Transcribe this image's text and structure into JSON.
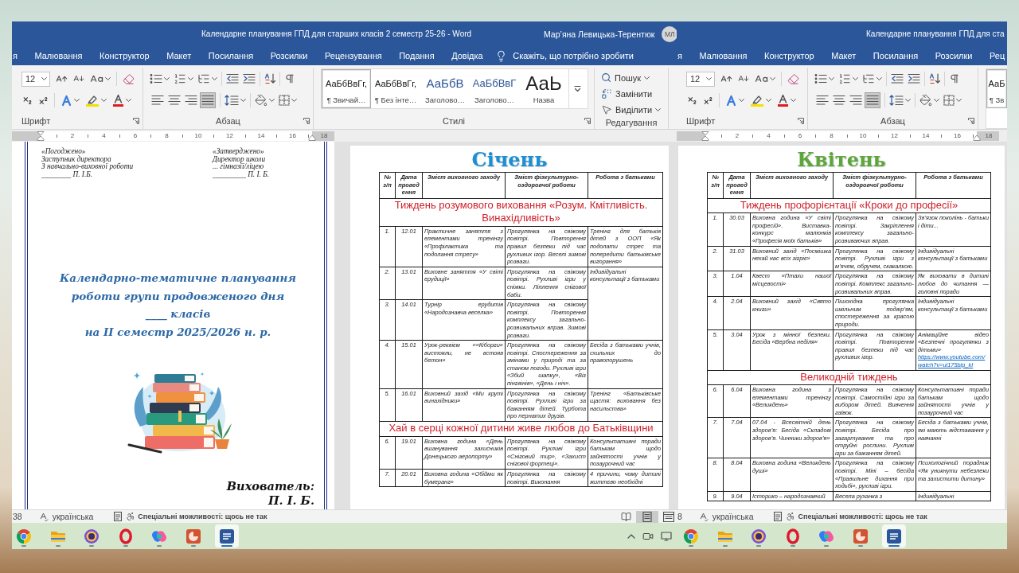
{
  "windows": [
    {
      "title": "Календарне планування ГПД для старших класів 2 семестр 25-26 - Word",
      "user_name": "Мар’яна Левицька-Терентюк",
      "user_initials": "МЛ",
      "tabs": [
        "я",
        "Малювання",
        "Конструктор",
        "Макет",
        "Посилання",
        "Розсилки",
        "Рецензування",
        "Подання",
        "Довідка"
      ],
      "tell_me": "Скажіть, що потрібно зробити",
      "ribbon": {
        "font_size": "12",
        "font_label": "Шрифт",
        "paragraph_label": "Абзац",
        "align_buttons": [
          {
            "kind": "left",
            "selected": false
          },
          {
            "kind": "center",
            "selected": false
          },
          {
            "kind": "right",
            "selected": false
          },
          {
            "kind": "justify",
            "selected": true
          }
        ],
        "styles": {
          "label": "Стилі",
          "tiles": [
            {
              "kind": "normal",
              "sample": "АаБбВвГг,",
              "name": "¶ Звичай…",
              "selected": true
            },
            {
              "kind": "no_spacing",
              "sample": "АаБбВвГг,",
              "name": "¶ Без інте…",
              "selected": false
            },
            {
              "kind": "heading1",
              "sample": "АаБбВ",
              "name": "Заголово…",
              "selected": false
            },
            {
              "kind": "heading2",
              "sample": "АаБбВвГ",
              "name": "Заголово…",
              "selected": false
            },
            {
              "kind": "title",
              "sample": "АаЬ",
              "name": "Назва",
              "selected": false
            }
          ]
        },
        "editing": {
          "label": "Редагування",
          "items": [
            {
              "kind": "find",
              "label": "Пошук",
              "menu": true
            },
            {
              "kind": "replace",
              "label": "Замінити",
              "menu": false
            },
            {
              "kind": "select",
              "label": "Виділити",
              "menu": true
            }
          ]
        }
      },
      "ruler": [
        "2",
        "4",
        "6",
        "8",
        "10",
        "12",
        "14",
        "16",
        "18"
      ],
      "pages": [
        {
          "kind": "cover",
          "approvals": [
            {
              "heading": "«Погоджено»",
              "lines": [
                "Заступник директора",
                "З навчально-виховної роботи",
                "________ П. І.Б."
              ]
            },
            {
              "heading": "«Затверджено»",
              "lines": [
                "Директор школи",
                "... гімназії/ліцею",
                "_________ П. І. Б."
              ]
            }
          ],
          "title_lines": [
            "Календарно-тематичне планування",
            "роботи групи продовженого дня",
            "____ класів",
            "на ІІ семестр 2025/2026 н. р."
          ],
          "signature_label": "Вихователь:",
          "signature_name": "П. І. Б."
        },
        {
          "kind": "plan",
          "title": "Січень",
          "color": "#1b8fd3",
          "columns": [
            "№ з/п",
            "Дата проведення",
            "Зміст виховного заходу",
            "Зміст фізкультурно-оздоровчої роботи",
            "Робота з батьками"
          ],
          "sections": [
            {
              "title": "Тиждень розумового виховання «Розум. Кмітливість. Винахідливість»",
              "rows": [
                {
                  "cells": [
                    "1.",
                    "12.01",
                    "Практичне заняття з елементами тренінгу «Профілактика та подолання стресу»",
                    "Прогулянка на свіжому повітрі. Повторення правил безпеки під час рухливих ігор. Веселі зимові розваги.",
                    "Тренінг для батьків дітей з ООП «Як подолати стрес та попередити батьківське вигорання»"
                  ]
                },
                {
                  "cells": [
                    "2.",
                    "13.01",
                    "Виховне заняття «У світі ерудиції»",
                    "Прогулянка на свіжому повітрі. Рухливі ігри у сніжки. Ліплення снігової баби.",
                    {
                      "text": "Індивідуальні консультації з батьками",
                      "rowspan": 2
                    }
                  ]
                },
                {
                  "cells": [
                    "3.",
                    "14.01",
                    "Турнір ерудитів «Народознавча веселка»",
                    "Прогулянка на свіжому повітрі. Повторення комплексу загально-розвивальних вправ. Зимові розваги."
                  ]
                },
                {
                  "cells": [
                    "4.",
                    "15.01",
                    "Урок-реквієм ««Кіборги» вистояли, не встояв бетон»",
                    "Прогулянка на свіжому повітрі. Спостереження за змінами у природі та за станом погоди. Рухливі ігри «Збий шапку», «Віз пінгвінів», «День і ніч».",
                    "Бесіда з батьками учнів, схильних до правопорушень"
                  ]
                },
                {
                  "cells": [
                    "5.",
                    "16.01",
                    "Виховний захід «Ми круті винахідники»",
                    "Прогулянка на свіжому повітрі. Рухливі ігри за бажанням дітей. Турбота про пернатих друзів.",
                    "Тренінг «Батьківське щастя: виховання без насильства»"
                  ]
                }
              ]
            },
            {
              "title": "Хай в серці кожної дитини живе любов до Батьківщини",
              "rows": [
                {
                  "cells": [
                    "6.",
                    "19.01",
                    "Виховна година «День вшанування захисників Донецького аеропорту»",
                    "Прогулянка на свіжому повітрі. Рухливі ігри «Сніговий тир», «Захист снігової фортеці».",
                    "Консультативні поради батькам щодо зайнятості учнів у позаурочний час"
                  ]
                },
                {
                  "cells": [
                    "7.",
                    "20.01",
                    "Виховна година «Обійми як бумеранг»",
                    "Прогулянка на свіжому повітрі. Виконання",
                    "4 причини, чому дитині життєво необхідні"
                  ]
                }
              ]
            }
          ]
        }
      ],
      "status_bar": {
        "page": "38",
        "language": "українська",
        "accessibility": "Спеціальні можливості: щось не так",
        "views": [
          {
            "kind": "read",
            "selected": false
          },
          {
            "kind": "print",
            "selected": true
          },
          {
            "kind": "web",
            "selected": false
          }
        ]
      },
      "taskbar": {
        "apps": [
          {
            "kind": "wheel",
            "running": true,
            "selected": false
          },
          {
            "kind": "folder",
            "running": true,
            "selected": false
          },
          {
            "kind": "ring",
            "running": true,
            "selected": false
          },
          {
            "kind": "o_ring",
            "running": true,
            "selected": false
          },
          {
            "kind": "swirl",
            "running": true,
            "selected": false
          },
          {
            "kind": "slides",
            "running": true,
            "selected": false
          },
          {
            "kind": "document",
            "running": true,
            "selected": true
          }
        ],
        "tray": [
          {
            "kind": "chevron"
          },
          {
            "kind": "camera"
          },
          {
            "kind": "screen"
          }
        ]
      }
    },
    {
      "title": "Календарне планування ГПД для ста",
      "tabs": [
        "я",
        "Малювання",
        "Конструктор",
        "Макет",
        "Посилання",
        "Розсилки",
        "Рец"
      ],
      "ribbon": {
        "font_size": "12",
        "font_label": "Шрифт",
        "paragraph_label": "Абзац",
        "align_buttons": [
          {
            "kind": "left",
            "selected": false
          },
          {
            "kind": "center",
            "selected": false
          },
          {
            "kind": "right",
            "selected": false
          },
          {
            "kind": "justify",
            "selected": true
          }
        ],
        "styles": {
          "tiles": [
            {
              "kind": "normal",
              "sample": "АаБ",
              "name": "¶ Зв",
              "selected": true
            }
          ]
        }
      },
      "ruler": [
        "2",
        "4",
        "6",
        "8",
        "10",
        "12",
        "14",
        "16",
        "18"
      ],
      "pages": [
        {
          "kind": "plan",
          "title": "Квітень",
          "color": "#5da63c",
          "columns": [
            "№ з/п",
            "Дата проведення",
            "Зміст виховного заходу",
            "Зміст фізкультурно-оздоровчої роботи",
            "Робота з батьками"
          ],
          "sections": [
            {
              "title": "Тиждень профорієнтації «Кроки до професії»",
              "rows": [
                {
                  "cells": [
                    "1.",
                    "30.03",
                    "Виховна година «У світі професій». Виставка-конкурс малюнків «Професія моїх батьків»",
                    "Прогулянка на свіжому повітрі. Закріплення комплексу загально-розвиваючих вправ.",
                    "Зв’язок поколінь - батьки і діти..."
                  ]
                },
                {
                  "cells": [
                    "2.",
                    "31.03",
                    "Виховний захід «Посмішка нехай нас всіх зігріє»",
                    "Прогулянка на свіжому повітрі. Рухливі ігри з м’ячем, обручем, скакалкою.",
                    "Індивідуальні консультації з батьками"
                  ]
                },
                {
                  "cells": [
                    "3.",
                    "1.04",
                    "Квест «Птахи нашої місцевості»",
                    "Прогулянка на свіжому повітрі. Комплекс загально-розвивальних вправ.",
                    "Як виховати в дитині любов до читання — головні поради"
                  ]
                },
                {
                  "cells": [
                    "4.",
                    "2.04",
                    "Виховний захід «Свято книги»",
                    "Пішохідна прогулянка шкільним подвір’ям, спостереження за красою природи.",
                    "Індивідуальні консультації з батьками"
                  ]
                },
                {
                  "cells": [
                    "5.",
                    "3.04",
                    "Урок з мінної безпеки. Бесіда «Вербна неділя»",
                    "Прогулянка на свіжому повітрі. Повторення правил безпеки під час рухливих ігор.",
                    "Анімаційне відео «Безпечні прогулянки з дітьми»"
                  ],
                  "link": "https://www.youtube.com/watch?v=ui175bip_kI"
                }
              ]
            },
            {
              "title": "Великодній тиждень",
              "rows": [
                {
                  "cells": [
                    "6.",
                    "6.04",
                    "Виховна година з елементами тренінгу «Великдень»",
                    "Прогулянка на свіжому повітрі. Самостійні ігри за вибором дітей. Вивчення гаївок.",
                    "Консультативні поради батькам щодо зайнятості учнів у позаурочний час"
                  ]
                },
                {
                  "cells": [
                    "7.",
                    "7.04",
                    "07.04 - Всесвітній день здоров’я: Бесіда «Складові здоров’я. Чинники здоров’я»",
                    "Прогулянка на свіжому повітрі. Бесіда про загартування та про отруйні рослини. Рухливі ігри за бажанням дітей.",
                    "Бесіда з батьками учнів, які мають відставання у навчанні"
                  ]
                },
                {
                  "cells": [
                    "8.",
                    "8.04",
                    "Виховна година «Великдень душі»",
                    "Прогулянка на свіжому повітрі. Міні – бесіда «Правильне дихання при ходьбі», рухливі ігри.",
                    "Психологічний порадник «Як уникнути небезпеки та захистити дитину»"
                  ]
                },
                {
                  "cells": [
                    "9.",
                    "9.04",
                    "Історико – народознавчий",
                    "Весела руханка з",
                    "Індивідуальні"
                  ]
                }
              ]
            }
          ]
        }
      ],
      "status_bar": {
        "page": "8",
        "language": "українська",
        "accessibility": "Спеціальні можливості: щось не так"
      },
      "taskbar": {
        "apps": [
          {
            "kind": "wheel",
            "running": true,
            "selected": false
          },
          {
            "kind": "folder",
            "running": true,
            "selected": false
          },
          {
            "kind": "ring",
            "running": true,
            "selected": false
          },
          {
            "kind": "o_ring",
            "running": true,
            "selected": false
          },
          {
            "kind": "swirl",
            "running": true,
            "selected": false
          },
          {
            "kind": "slides",
            "running": true,
            "selected": false
          },
          {
            "kind": "document",
            "running": true,
            "selected": true
          }
        ]
      }
    }
  ]
}
